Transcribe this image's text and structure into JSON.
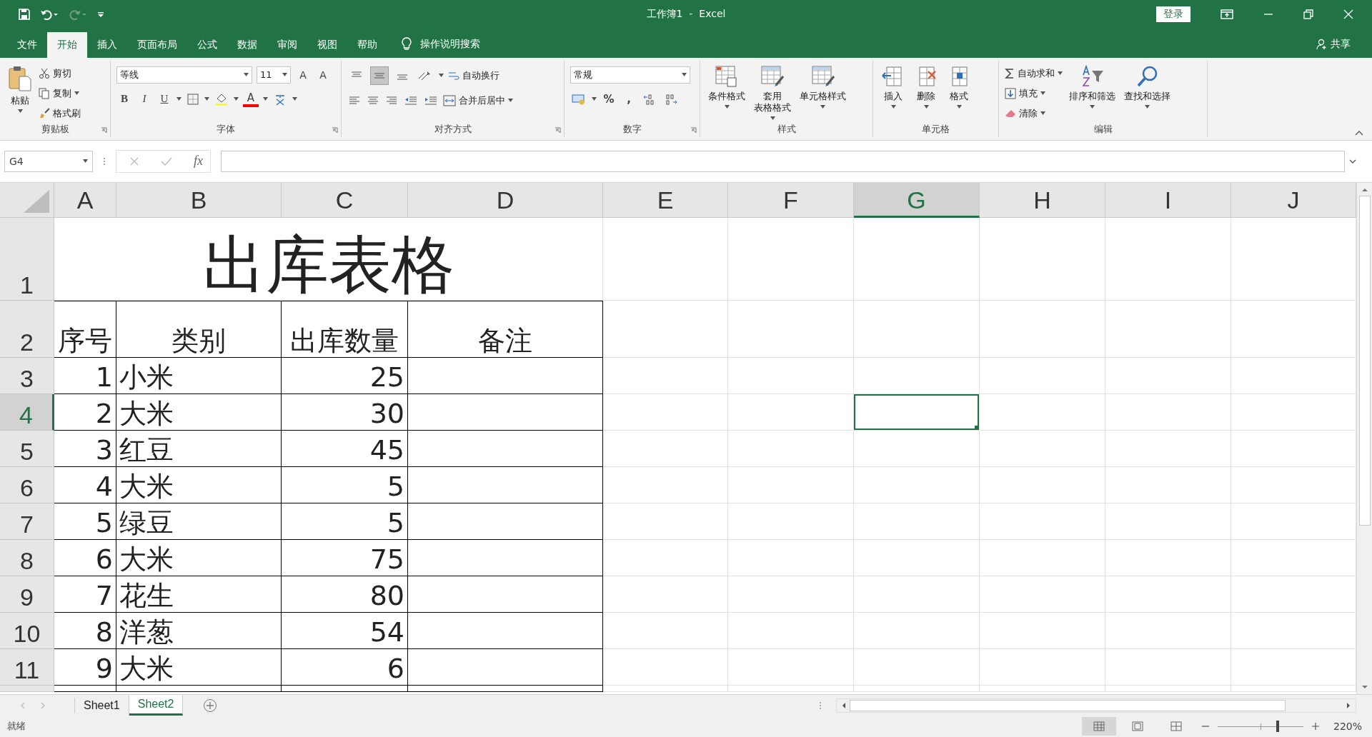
{
  "title_bar": {
    "title": "工作簿1  -  Excel",
    "login": "登录"
  },
  "menu_tabs": [
    {
      "label": "文件",
      "selected": false
    },
    {
      "label": "开始",
      "selected": true
    },
    {
      "label": "插入",
      "selected": false
    },
    {
      "label": "页面布局",
      "selected": false
    },
    {
      "label": "公式",
      "selected": false
    },
    {
      "label": "数据",
      "selected": false
    },
    {
      "label": "审阅",
      "selected": false
    },
    {
      "label": "视图",
      "selected": false
    },
    {
      "label": "帮助",
      "selected": false
    }
  ],
  "search_hint": "操作说明搜索",
  "share": "共享",
  "ribbon": {
    "clipboard": {
      "paste": "粘贴",
      "cut": "剪切",
      "copy": "复制",
      "painter": "格式刷",
      "label": "剪贴板"
    },
    "font": {
      "font_name": "等线",
      "font_size": "11",
      "grow": "A",
      "shrink": "A",
      "bold": "B",
      "italic": "I",
      "underline": "U",
      "font_color": "A",
      "label": "字体"
    },
    "alignment": {
      "vertical_align": [
        {
          "selected": false
        },
        {
          "selected": true
        },
        {
          "selected": false
        }
      ],
      "wrap": "自动换行",
      "merge": "合并后居中",
      "label": "对齐方式"
    },
    "number": {
      "format": "常规",
      "percent": "%",
      "comma": ",",
      "label": "数字"
    },
    "styles": {
      "items": [
        [
          "条件格式"
        ],
        [
          "套用",
          "表格格式"
        ],
        [
          "单元格样式"
        ]
      ],
      "label": "样式"
    },
    "cells": {
      "items": [
        "插入",
        "删除",
        "格式"
      ],
      "label": "单元格"
    },
    "editing": {
      "autosum": "自动求和",
      "fill": "填充",
      "clear": "清除",
      "sort": "排序和筛选",
      "find": "查找和选择",
      "label": "编辑"
    }
  },
  "formula_bar": {
    "name_box": "G4",
    "fx": "fx"
  },
  "columns": [
    {
      "label": "A",
      "selected": false
    },
    {
      "label": "B",
      "selected": false
    },
    {
      "label": "C",
      "selected": false
    },
    {
      "label": "D",
      "selected": false
    },
    {
      "label": "E",
      "selected": false
    },
    {
      "label": "F",
      "selected": false
    },
    {
      "label": "G",
      "selected": true
    },
    {
      "label": "H",
      "selected": false
    },
    {
      "label": "I",
      "selected": false
    },
    {
      "label": "J",
      "selected": false
    }
  ],
  "rows": [
    {
      "header": "1",
      "selected": false,
      "kind": "title",
      "title": "出库表格"
    },
    {
      "header": "2",
      "selected": false,
      "kind": "header",
      "cells": [
        "序号",
        "类别",
        "出库数量",
        "备注"
      ]
    },
    {
      "header": "3",
      "selected": false,
      "kind": "data",
      "cells": [
        "1",
        "小米",
        "25"
      ]
    },
    {
      "header": "4",
      "selected": true,
      "kind": "data",
      "cells": [
        "2",
        "大米",
        "30"
      ]
    },
    {
      "header": "5",
      "selected": false,
      "kind": "data",
      "cells": [
        "3",
        "红豆",
        "45"
      ]
    },
    {
      "header": "6",
      "selected": false,
      "kind": "data",
      "cells": [
        "4",
        "大米",
        "5"
      ]
    },
    {
      "header": "7",
      "selected": false,
      "kind": "data",
      "cells": [
        "5",
        "绿豆",
        "5"
      ]
    },
    {
      "header": "8",
      "selected": false,
      "kind": "data",
      "cells": [
        "6",
        "大米",
        "75"
      ]
    },
    {
      "header": "9",
      "selected": false,
      "kind": "data",
      "cells": [
        "7",
        "花生",
        "80"
      ]
    },
    {
      "header": "10",
      "selected": false,
      "kind": "data",
      "cells": [
        "8",
        "洋葱",
        "54"
      ]
    },
    {
      "header": "11",
      "selected": false,
      "kind": "data",
      "cells": [
        "9",
        "大米",
        "6"
      ]
    }
  ],
  "sheets": [
    {
      "label": "Sheet1",
      "selected": false
    },
    {
      "label": "Sheet2",
      "selected": true
    }
  ],
  "status_bar": {
    "status": "就绪",
    "views": [
      {
        "selected": true
      },
      {
        "selected": false
      },
      {
        "selected": false
      }
    ],
    "zoom_slider": {
      "level": 0.7
    },
    "zoom": "220%"
  }
}
